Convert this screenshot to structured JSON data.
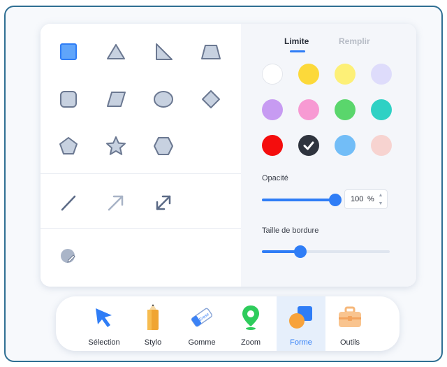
{
  "tabs": {
    "border": "Limite",
    "fill": "Remplir"
  },
  "colors": {
    "accent": "#2f7df6",
    "shape_stroke": "#6b7891",
    "shape_fill": "#c7d1e0",
    "selected_shape_fill": "#60a5fa"
  },
  "swatches": [
    {
      "color": "#ffffff",
      "selected": false
    },
    {
      "color": "#fcd93a",
      "selected": false
    },
    {
      "color": "#fdf077",
      "selected": false
    },
    {
      "color": "#dedcfb",
      "selected": false
    },
    {
      "color": "#c79bf2",
      "selected": false
    },
    {
      "color": "#f79ad3",
      "selected": false
    },
    {
      "color": "#5ad66c",
      "selected": false
    },
    {
      "color": "#2fd1c4",
      "selected": false
    },
    {
      "color": "#f40d0d",
      "selected": false
    },
    {
      "color": "#2f343e",
      "selected": true
    },
    {
      "color": "#72bdf7",
      "selected": false
    },
    {
      "color": "#f7d3d0",
      "selected": false
    }
  ],
  "opacity": {
    "label": "Opacité",
    "value": "100",
    "unit": "%",
    "fraction": 1.0
  },
  "border_size": {
    "label": "Taille de bordure",
    "fraction": 0.3
  },
  "shapes": [
    "square-icon",
    "triangle-icon",
    "right-triangle-icon",
    "trapezoid-icon",
    "rounded-square-icon",
    "parallelogram-icon",
    "ellipse-icon",
    "diamond-icon",
    "pentagon-icon",
    "star-icon",
    "hexagon-icon"
  ],
  "lines": [
    "line-icon",
    "arrow-icon",
    "double-arrow-icon"
  ],
  "toolbar": {
    "selection": "Sélection",
    "pen": "Stylo",
    "eraser": "Gomme",
    "zoom": "Zoom",
    "shape": "Forme",
    "tools": "Outils",
    "eraser_icon_text": "Erase"
  }
}
